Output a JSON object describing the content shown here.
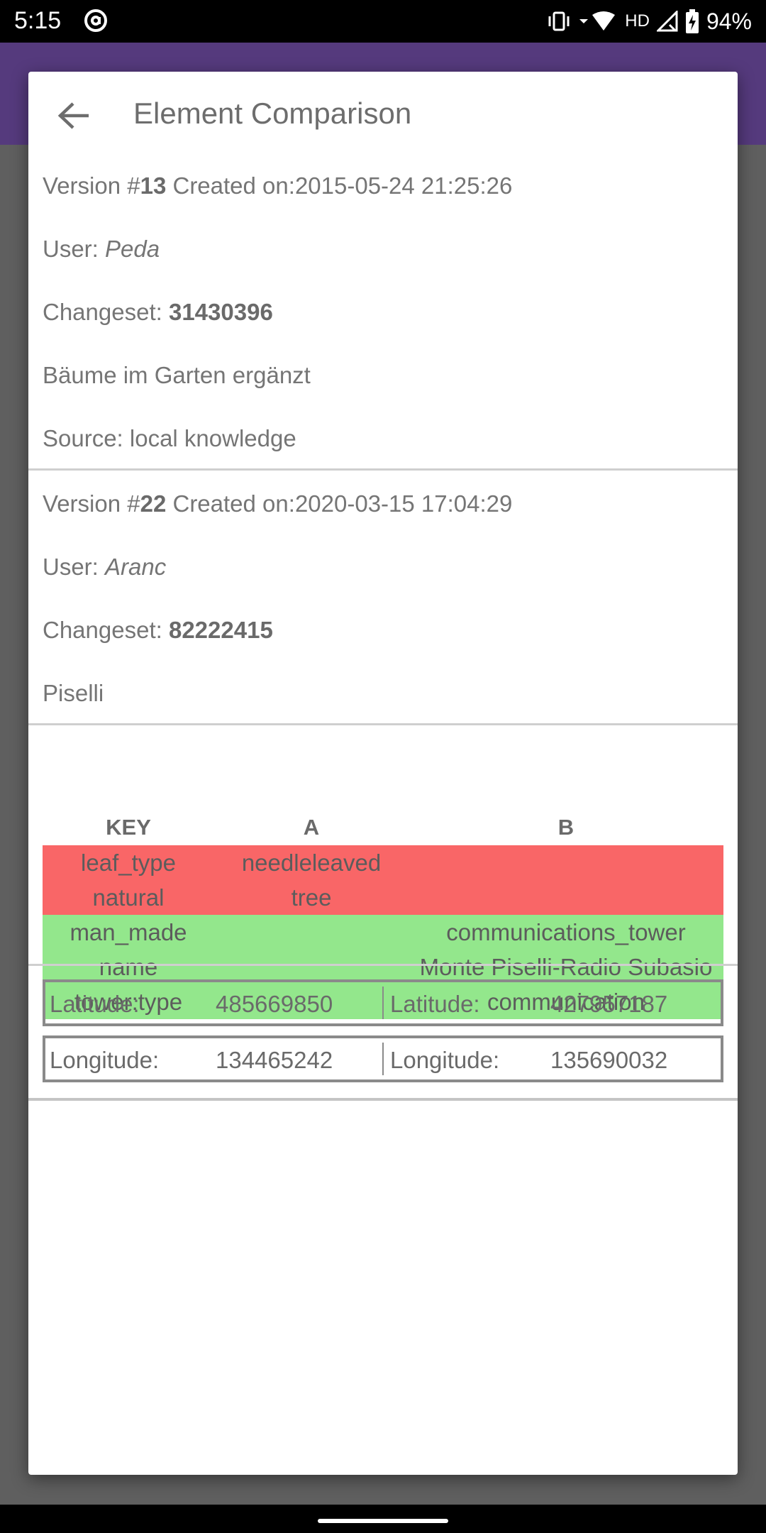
{
  "status_bar": {
    "time": "5:15",
    "network": "HD",
    "battery": "94%",
    "icons": [
      "at-sign-icon",
      "vibrate-icon",
      "wifi-icon",
      "signal-icon",
      "battery-charging-icon"
    ]
  },
  "dialog": {
    "title": "Element Comparison",
    "back_icon": "arrow-back-icon"
  },
  "version_a": {
    "version_prefix": "Version #",
    "version_number": "13",
    "created_prefix": " Created on:",
    "created_on": "2015-05-24 21:25:26",
    "user_label": "User: ",
    "user": "Peda",
    "changeset_label": "Changeset: ",
    "changeset": "31430396",
    "comment": "Bäume im Garten ergänzt",
    "source": "Source: local knowledge"
  },
  "version_b": {
    "version_prefix": "Version #",
    "version_number": "22",
    "created_prefix": " Created on:",
    "created_on": "2020-03-15 17:04:29",
    "user_label": "User: ",
    "user": "Aranc",
    "changeset_label": "Changeset: ",
    "changeset": "82222415",
    "comment": "Piselli"
  },
  "tags": {
    "headers": {
      "key": "KEY",
      "a": "A",
      "b": "B"
    },
    "colors": {
      "removed": "#f96667",
      "added": "#93e78c"
    },
    "rows": [
      {
        "key": "leaf_type",
        "a": "needleleaved",
        "b": "",
        "status": "removed"
      },
      {
        "key": "natural",
        "a": "tree",
        "b": "",
        "status": "removed"
      },
      {
        "key": "man_made",
        "a": "",
        "b": "communications_tower",
        "status": "added"
      },
      {
        "key": "name",
        "a": "",
        "b": "Monte Piselli-Radio Subasio",
        "status": "added"
      },
      {
        "key": "tower:type",
        "a": "",
        "b": "communication",
        "status": "added"
      }
    ]
  },
  "coordinates": {
    "latitude": {
      "label_a": "Latitude:",
      "value_a": "485669850",
      "label_b": "Latitude:",
      "value_b": "427957187"
    },
    "longitude": {
      "label_a": "Longitude:",
      "value_a": "134465242",
      "label_b": "Longitude:",
      "value_b": "135690032"
    }
  }
}
